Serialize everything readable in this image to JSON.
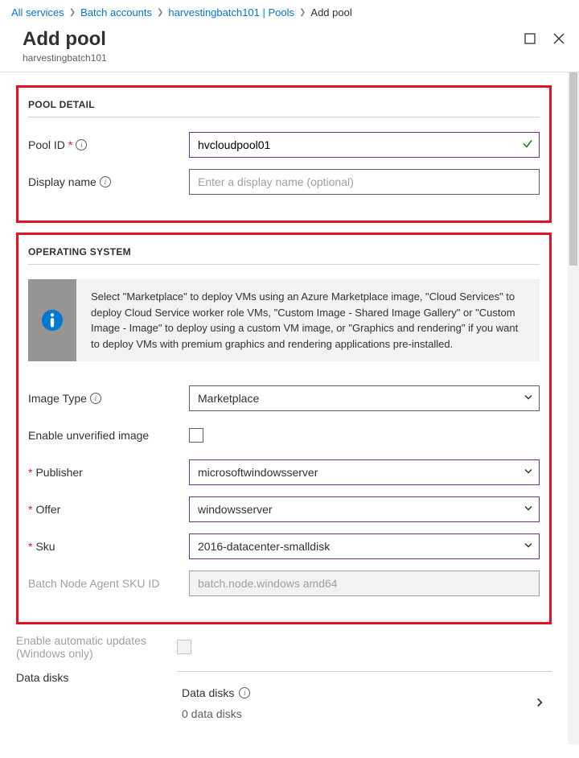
{
  "breadcrumb": {
    "items": [
      {
        "label": "All services",
        "link": true
      },
      {
        "label": "Batch accounts",
        "link": true
      },
      {
        "label": "harvestingbatch101 | Pools",
        "link": true
      },
      {
        "label": "Add pool",
        "link": false
      }
    ]
  },
  "header": {
    "title": "Add pool",
    "subtitle": "harvestingbatch101"
  },
  "pool_detail": {
    "section_title": "POOL DETAIL",
    "pool_id_label": "Pool ID",
    "pool_id_value": "hvcloudpool01",
    "display_name_label": "Display name",
    "display_name_placeholder": "Enter a display name (optional)"
  },
  "os": {
    "section_title": "OPERATING SYSTEM",
    "callout": "Select \"Marketplace\" to deploy VMs using an Azure Marketplace image, \"Cloud Services\" to deploy Cloud Service worker role VMs, \"Custom Image - Shared Image Gallery\" or \"Custom Image - Image\" to deploy using a custom VM image, or \"Graphics and rendering\" if you want to deploy VMs with premium graphics and rendering applications pre-installed.",
    "image_type_label": "Image Type",
    "image_type_value": "Marketplace",
    "enable_unverified_label": "Enable unverified image",
    "publisher_label": "Publisher",
    "publisher_value": "microsoftwindowsserver",
    "offer_label": "Offer",
    "offer_value": "windowsserver",
    "sku_label": "Sku",
    "sku_value": "2016-datacenter-smalldisk",
    "agent_sku_label": "Batch Node Agent SKU ID",
    "agent_sku_value": "batch.node.windows amd64",
    "auto_updates_label_1": "Enable automatic updates",
    "auto_updates_label_2": "(Windows only)",
    "data_disks_label": "Data disks",
    "data_disks_title": "Data disks",
    "data_disks_count": "0 data disks"
  }
}
